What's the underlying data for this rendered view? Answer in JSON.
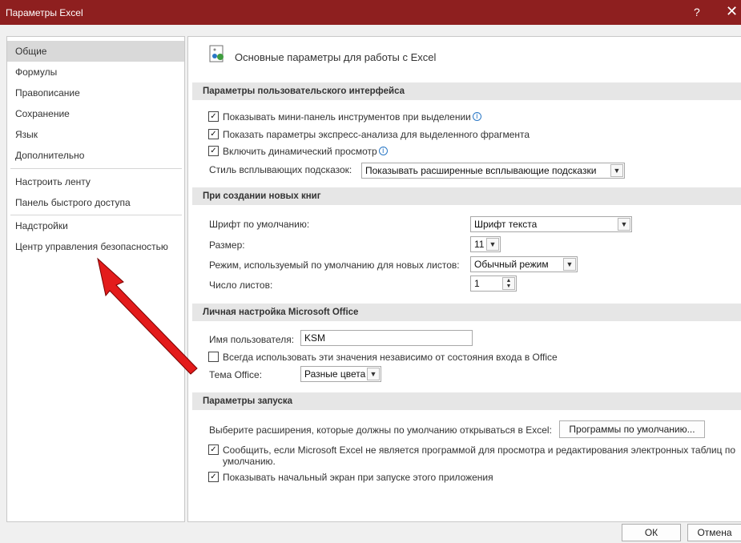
{
  "window": {
    "title": "Параметры Excel",
    "help_glyph": "?",
    "close_glyph": "✕"
  },
  "sidebar": {
    "items": [
      {
        "label": "Общие"
      },
      {
        "label": "Формулы"
      },
      {
        "label": "Правописание"
      },
      {
        "label": "Сохранение"
      },
      {
        "label": "Язык"
      },
      {
        "label": "Дополнительно"
      },
      {
        "label": "Настроить ленту"
      },
      {
        "label": "Панель быстрого доступа"
      },
      {
        "label": "Надстройки"
      },
      {
        "label": "Центр управления безопасностью"
      }
    ]
  },
  "main": {
    "header": "Основные параметры для работы с Excel",
    "ui_section": {
      "title": "Параметры пользовательского интерфейса",
      "options": [
        {
          "label": "Показывать мини-панель инструментов при выделении",
          "checked": "✓",
          "info": "i"
        },
        {
          "label": "Показать параметры экспресс-анализа для выделенного фрагмента",
          "checked": "✓"
        },
        {
          "label": "Включить динамический просмотр",
          "checked": "✓",
          "info": "i"
        }
      ],
      "tooltip_style_label": "Стиль всплывающих подсказок:",
      "tooltip_style_value": "Показывать расширенные всплывающие подсказки"
    },
    "new_books": {
      "title": "При создании новых книг",
      "font_label": "Шрифт по умолчанию:",
      "font_value": "Шрифт текста",
      "size_label": "Размер:",
      "size_value": "11",
      "mode_label": "Режим, используемый по умолчанию для новых листов:",
      "mode_value": "Обычный режим",
      "sheets_label": "Число листов:",
      "sheets_value": "1"
    },
    "personal": {
      "title": "Личная настройка Microsoft Office",
      "username_label": "Имя пользователя:",
      "username_value": "KSM",
      "always_label": "Всегда использовать эти значения независимо от состояния входа в Office",
      "theme_label": "Тема Office:",
      "theme_value": "Разные цвета"
    },
    "startup": {
      "title": "Параметры запуска",
      "extensions_label": "Выберите расширения, которые должны по умолчанию открываться в Excel:",
      "default_programs_button": "Программы по умолчанию...",
      "notify_label_line1": "Сообщить, если Microsoft Excel не является программой для просмотра и редактирования электронных таблиц по",
      "notify_label_line2": "умолчанию.",
      "notify_checked": "✓",
      "start_screen_label": "Показывать начальный экран при запуске этого приложения",
      "start_screen_checked": "✓"
    }
  },
  "footer": {
    "ok": "ОК",
    "cancel": "Отмена"
  },
  "colors": {
    "titlebar": "#8e1f1f",
    "arrow": "#e31b1b",
    "section_bg": "#e6e6e6"
  }
}
